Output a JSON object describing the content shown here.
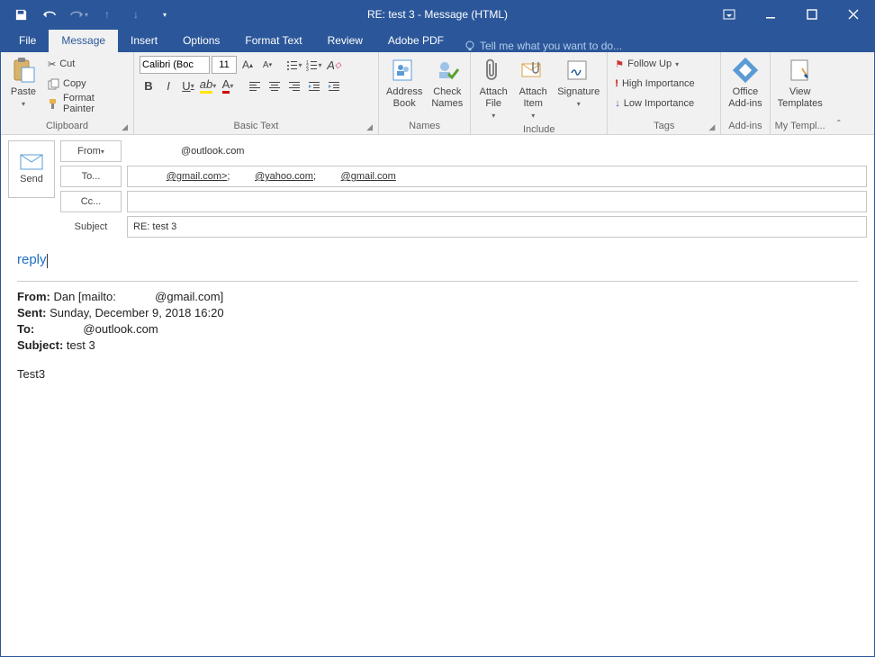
{
  "window": {
    "title": "RE: test 3 - Message (HTML)"
  },
  "tabs": {
    "file": "File",
    "message": "Message",
    "insert": "Insert",
    "options": "Options",
    "format": "Format Text",
    "review": "Review",
    "adobe": "Adobe PDF",
    "tellme": "Tell me what you want to do..."
  },
  "ribbon": {
    "clipboard": {
      "label": "Clipboard",
      "paste": "Paste",
      "cut": "Cut",
      "copy": "Copy",
      "format_painter": "Format Painter"
    },
    "basictext": {
      "label": "Basic Text",
      "font_name": "Calibri (Boc",
      "font_size": "11"
    },
    "names": {
      "label": "Names",
      "address_book": "Address\nBook",
      "check_names": "Check\nNames"
    },
    "include": {
      "label": "Include",
      "attach_file": "Attach\nFile",
      "attach_item": "Attach\nItem",
      "signature": "Signature"
    },
    "tags": {
      "label": "Tags",
      "follow_up": "Follow Up",
      "high": "High Importance",
      "low": "Low Importance"
    },
    "addins": {
      "label": "Add-ins",
      "office": "Office\nAdd-ins"
    },
    "templates": {
      "label": "My Templ...",
      "view": "View\nTemplates"
    }
  },
  "compose": {
    "send": "Send",
    "from_label": "From",
    "from_value": "@outlook.com",
    "to_label": "To...",
    "to_value_1": "@gmail.com>",
    "to_value_2": "@yahoo.com",
    "to_value_3": "@gmail.com",
    "cc_label": "Cc...",
    "cc_value": "",
    "subject_label": "Subject",
    "subject_value": "RE: test 3"
  },
  "body": {
    "reply_text": "reply",
    "orig_from_label": "From:",
    "orig_from_value": " Dan [mailto:            @gmail.com]",
    "orig_sent_label": "Sent:",
    "orig_sent_value": " Sunday, December 9, 2018 16:20",
    "orig_to_label": "To:",
    "orig_to_value": "               @outlook.com",
    "orig_subject_label": "Subject:",
    "orig_subject_value": " test 3",
    "orig_body": "Test3"
  }
}
